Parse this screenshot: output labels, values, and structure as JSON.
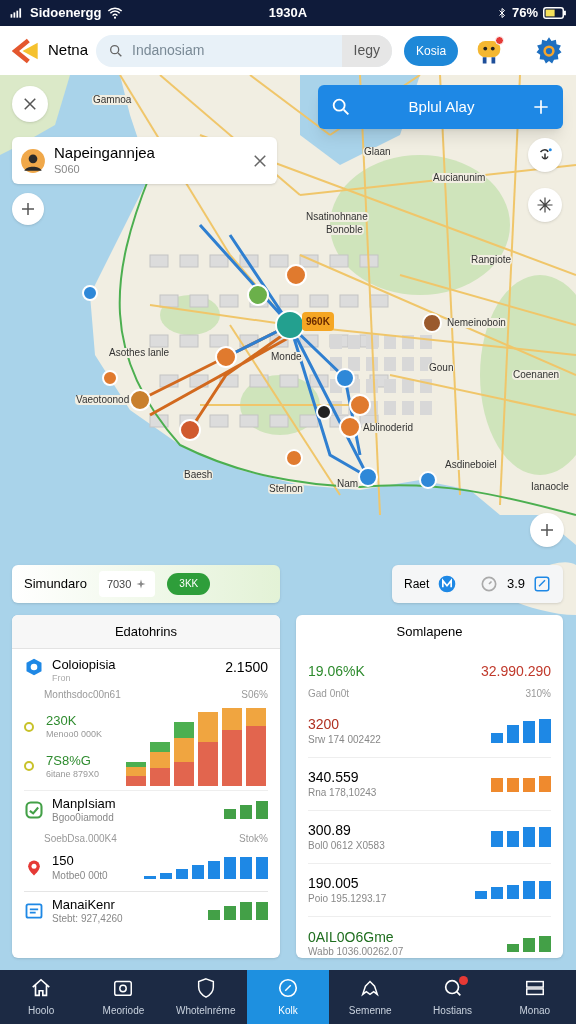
{
  "status_bar": {
    "carrier": "Sidoenergg",
    "time": "1930A",
    "battery": "76%"
  },
  "header": {
    "app_name": "Netna",
    "search": {
      "placeholder": "Indanosiam",
      "suffix": "Iegy"
    },
    "button": "Kosia"
  },
  "map": {
    "search_bar": {
      "label": "Bplul Alay"
    },
    "place_card": {
      "title": "Napeingannjea",
      "subtitle": "S060"
    },
    "callout": "960K",
    "labels": [
      "Gamnoa",
      "Glaan",
      "Aucianunim",
      "Nsatinohnane",
      "Bonoble",
      "Rangiote",
      "Nemeinoboin",
      "Asothes lanle",
      "Monde",
      "Goun",
      "Coenanen",
      "Vaeotoonod",
      "Ablinoderid",
      "Asdineboiel",
      "Baesh",
      "Nam",
      "Stelnon",
      "Ianaocle"
    ]
  },
  "summary_bar": {
    "label": "Simundaro",
    "chip": "7030",
    "pill": "3KK"
  },
  "rating_chip": {
    "label": "Raet",
    "value": "3.9"
  },
  "left_panel": {
    "title": "Edatohrins",
    "items": [
      {
        "kind": "headline",
        "title": "Coloiopisia",
        "value": "2.1500",
        "subtitle": "Fron"
      },
      {
        "kind": "note",
        "text": "Monthsdoc00n61",
        "percent": "S06%"
      },
      {
        "kind": "timeline",
        "entries": [
          {
            "value": "230K",
            "caption": "Menoo0 000K"
          },
          {
            "value": "7S8%G",
            "caption": "6itane 879X0"
          }
        ]
      },
      {
        "kind": "bars",
        "title": "ManpIsiam",
        "subtitle": "Bgoo0iamodd",
        "color": "#43a047"
      },
      {
        "kind": "note",
        "text": "SoebDsa.000K4",
        "percent": "Stok%"
      },
      {
        "kind": "marker",
        "title": "150",
        "subtitle": "Motbe0 00t0",
        "color": "#1e88e5"
      },
      {
        "kind": "bars",
        "title": "ManaiKenr",
        "subtitle": "Stebt: 927,4260",
        "color": "#43a047"
      }
    ]
  },
  "right_panel": {
    "title": "Somlapene",
    "total": {
      "change": "19.06%K",
      "amount": "32.990.290"
    },
    "note": {
      "text": "Gad 0n0t",
      "percent": "310%"
    },
    "rows": [
      {
        "value": "3200",
        "caption": "Srw 174 002422",
        "color": "#1e88e5"
      },
      {
        "value": "340.559",
        "caption": "Rna 178,10243",
        "color": "#ef8a2e"
      },
      {
        "value": "300.89",
        "caption": "Bol0 0612 X0583",
        "color": "#1e88e5"
      },
      {
        "value": "190.005",
        "caption": "Poio 195.1293.17",
        "color": "#1e88e5"
      },
      {
        "value": "0AIL0O6Gme",
        "caption": "Wabb 1036.00262.07",
        "color": "#43a047"
      }
    ]
  },
  "bottom_nav": [
    {
      "label": "Hoolo",
      "selected": false,
      "badge": false
    },
    {
      "label": "Meoriode",
      "selected": false,
      "badge": false
    },
    {
      "label": "Whotelnréme",
      "selected": false,
      "badge": false
    },
    {
      "label": "Kolk",
      "selected": true,
      "badge": false
    },
    {
      "label": "Semenne",
      "selected": false,
      "badge": false
    },
    {
      "label": "Hostians",
      "selected": false,
      "badge": true
    },
    {
      "label": "Monao",
      "selected": false,
      "badge": false
    }
  ]
}
